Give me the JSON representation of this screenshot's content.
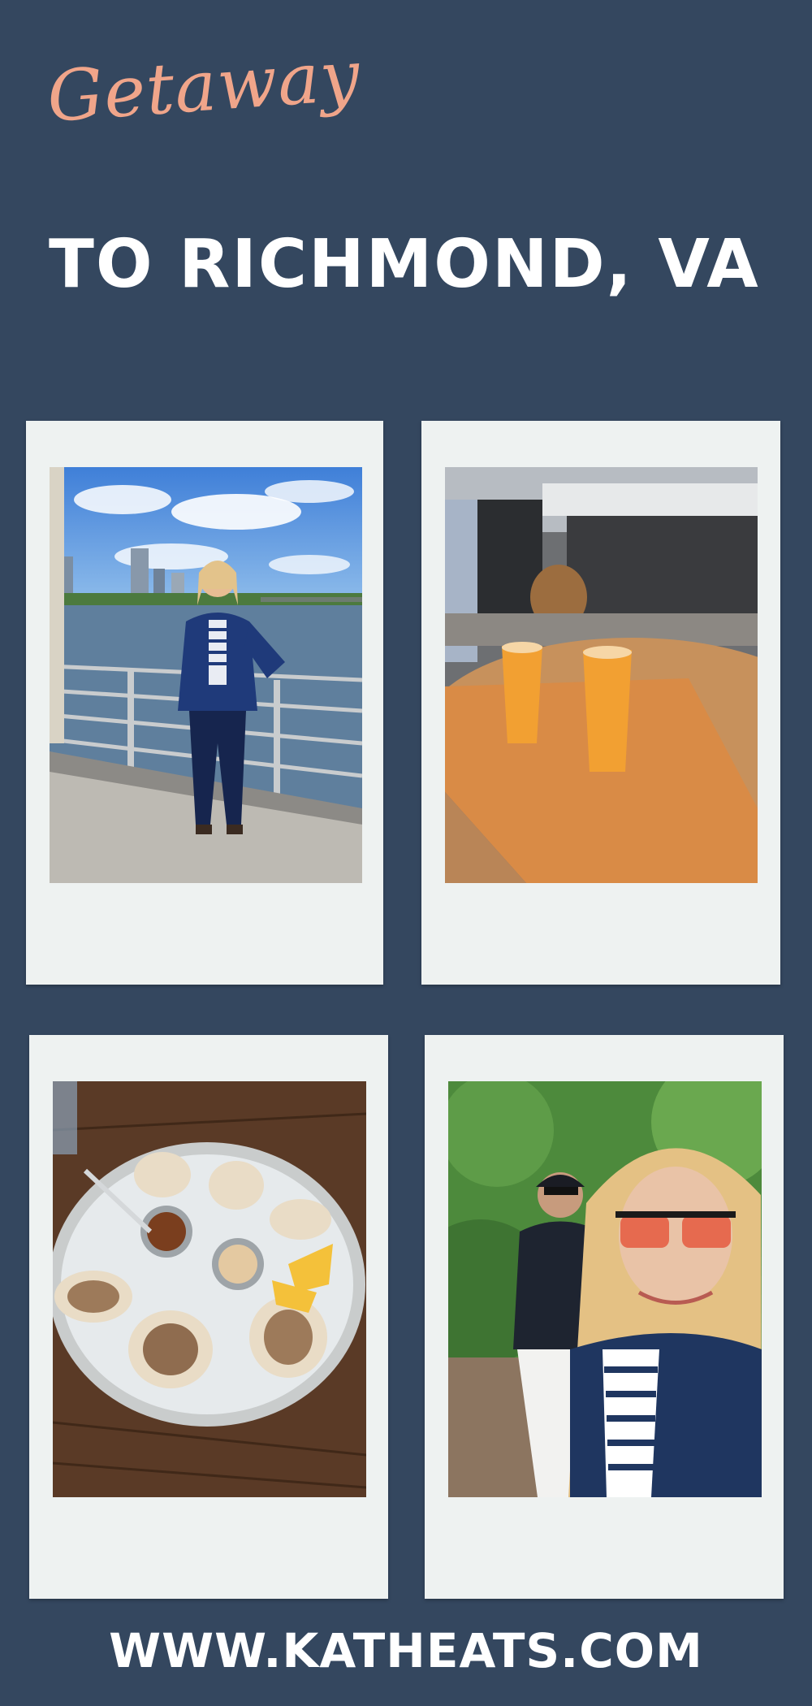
{
  "header": {
    "script_title": "Getaway",
    "main_title": "TO RICHMOND, VA"
  },
  "photos": [
    {
      "subject": "woman-on-bridge-photo"
    },
    {
      "subject": "beer-flight-photo"
    },
    {
      "subject": "oysters-photo"
    },
    {
      "subject": "selfie-couple-photo"
    }
  ],
  "footer": {
    "url": "WWW.KATHEATS.COM"
  },
  "colors": {
    "background": "#34475f",
    "accent": "#f0a58a",
    "frame": "#eef2f1"
  }
}
